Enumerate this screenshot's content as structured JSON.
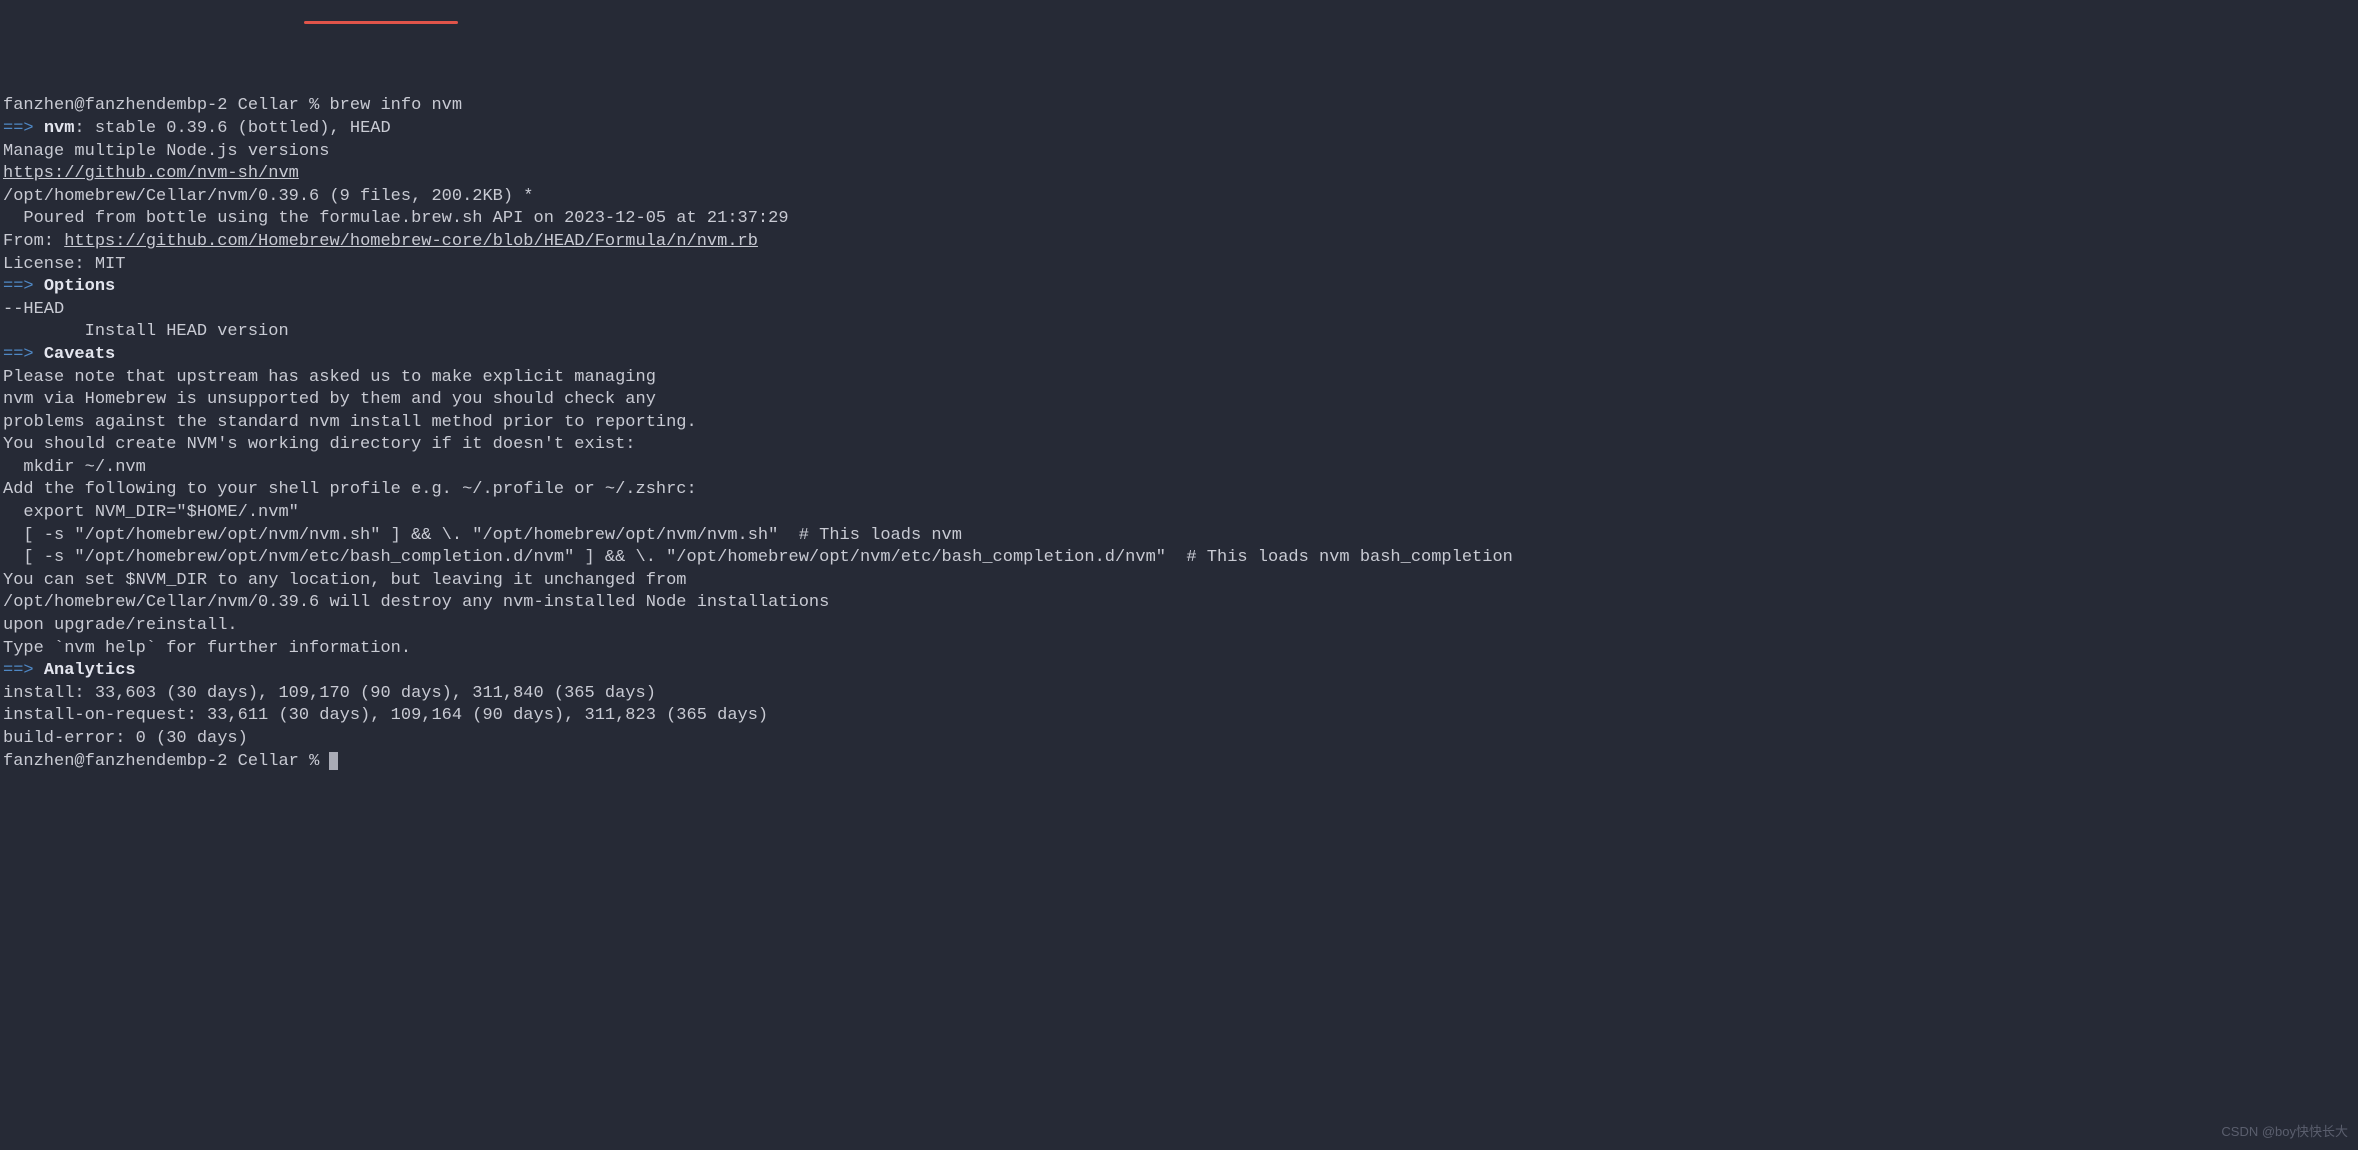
{
  "prompt1": {
    "user_host": "fanzhen@fanzhendembp-2",
    "dir": "Cellar",
    "symbol": "%",
    "command": "brew info nvm"
  },
  "header": {
    "arrow": "==>",
    "name": "nvm",
    "rest": ": stable 0.39.6 (bottled), HEAD"
  },
  "description": "Manage multiple Node.js versions",
  "homepage": "https://github.com/nvm-sh/nvm",
  "install_path": "/opt/homebrew/Cellar/nvm/0.39.6 (9 files, 200.2KB) *",
  "poured": "  Poured from bottle using the formulae.brew.sh API on 2023-12-05 at 21:37:29",
  "from_label": "From: ",
  "from_url": "https://github.com/Homebrew/homebrew-core/blob/HEAD/Formula/n/nvm.rb",
  "license": "License: MIT",
  "options": {
    "arrow": "==>",
    "title": "Options",
    "opt1": "--HEAD",
    "opt1_desc": "        Install HEAD version"
  },
  "caveats": {
    "arrow": "==>",
    "title": "Caveats",
    "l1": "Please note that upstream has asked us to make explicit managing",
    "l2": "nvm via Homebrew is unsupported by them and you should check any",
    "l3": "problems against the standard nvm install method prior to reporting.",
    "l4": "",
    "l5": "You should create NVM's working directory if it doesn't exist:",
    "l6": "  mkdir ~/.nvm",
    "l7": "",
    "l8": "Add the following to your shell profile e.g. ~/.profile or ~/.zshrc:",
    "l9": "  export NVM_DIR=\"$HOME/.nvm\"",
    "l10": "  [ -s \"/opt/homebrew/opt/nvm/nvm.sh\" ] && \\. \"/opt/homebrew/opt/nvm/nvm.sh\"  # This loads nvm",
    "l11": "  [ -s \"/opt/homebrew/opt/nvm/etc/bash_completion.d/nvm\" ] && \\. \"/opt/homebrew/opt/nvm/etc/bash_completion.d/nvm\"  # This loads nvm bash_completion",
    "l12": "",
    "l13": "You can set $NVM_DIR to any location, but leaving it unchanged from",
    "l14": "/opt/homebrew/Cellar/nvm/0.39.6 will destroy any nvm-installed Node installations",
    "l15": "upon upgrade/reinstall.",
    "l16": "",
    "l17": "Type `nvm help` for further information."
  },
  "analytics": {
    "arrow": "==>",
    "title": "Analytics",
    "install": "install: 33,603 (30 days), 109,170 (90 days), 311,840 (365 days)",
    "install_on_request": "install-on-request: 33,611 (30 days), 109,164 (90 days), 311,823 (365 days)",
    "build_error": "build-error: 0 (30 days)"
  },
  "prompt2": {
    "user_host": "fanzhen@fanzhendembp-2",
    "dir": "Cellar",
    "symbol": "%"
  },
  "watermark": "CSDN @boy快快长大"
}
